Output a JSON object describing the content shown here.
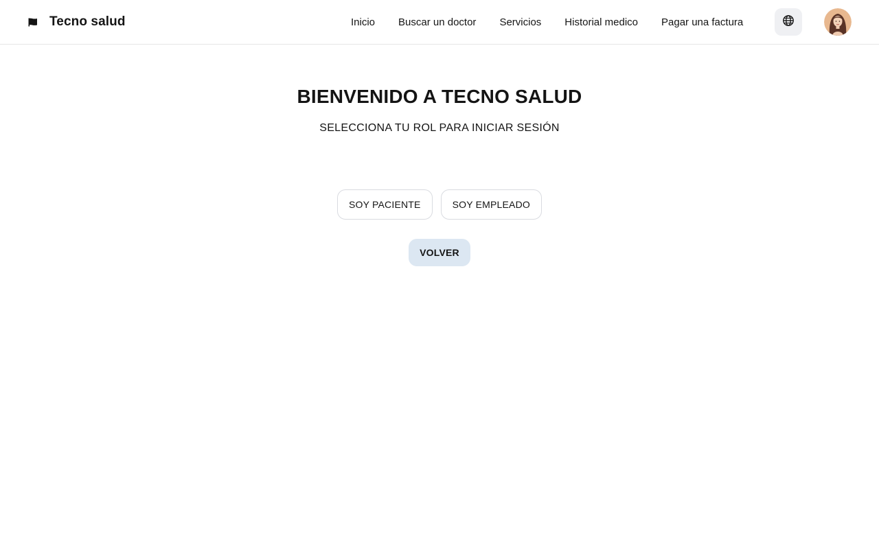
{
  "header": {
    "brand_icon": "flag-icon",
    "brand_name": "Tecno salud",
    "nav": [
      {
        "label": "Inicio"
      },
      {
        "label": "Buscar un doctor"
      },
      {
        "label": "Servicios"
      },
      {
        "label": "Historial medico"
      },
      {
        "label": "Pagar una factura"
      }
    ],
    "language_icon": "globe-icon",
    "avatar_icon": "user-avatar"
  },
  "main": {
    "title": "BIENVENIDO A TECNO SALUD",
    "subtitle": "SELECCIONA TU ROL PARA INICIAR SESIÓN",
    "role_patient_label": "SOY PACIENTE",
    "role_employee_label": "SOY EMPLEADO",
    "back_label": "VOLVER"
  },
  "colors": {
    "text": "#141414",
    "border": "#e6e6e6",
    "lang_button_bg": "#eff0f3",
    "back_button_bg": "#dce7f2"
  }
}
